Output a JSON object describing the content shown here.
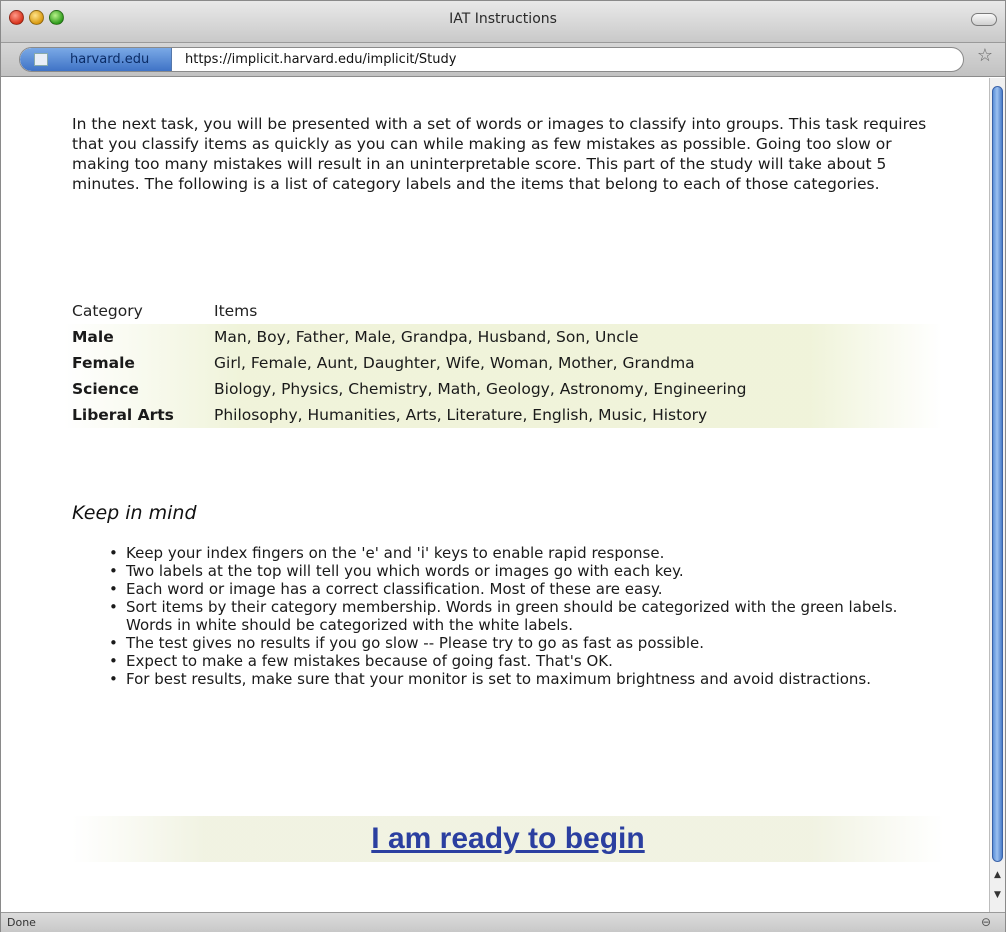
{
  "window": {
    "title": "IAT Instructions"
  },
  "urlbar": {
    "site_label": "harvard.edu",
    "url": "https://implicit.harvard.edu/implicit/Study"
  },
  "content": {
    "intro": "In the next task, you will be presented with a set of words or images to classify into groups. This task requires that you classify items as quickly as you can while making as few mistakes as possible. Going too slow or making too many mistakes will result in an uninterpretable score. This part of the study will take about 5 minutes. The following is a list of category labels and the items that belong to each of those categories.",
    "table": {
      "headers": [
        "Category",
        "Items"
      ],
      "rows": [
        {
          "category": "Male",
          "items": "Man, Boy, Father, Male, Grandpa, Husband, Son, Uncle"
        },
        {
          "category": "Female",
          "items": "Girl, Female, Aunt, Daughter, Wife, Woman, Mother, Grandma"
        },
        {
          "category": "Science",
          "items": "Biology, Physics, Chemistry, Math, Geology, Astronomy, Engineering"
        },
        {
          "category": "Liberal Arts",
          "items": "Philosophy, Humanities, Arts, Literature, English, Music, History"
        }
      ]
    },
    "keep_in_mind": "Keep in mind",
    "tips": [
      "Keep your index fingers on the 'e' and 'i' keys to enable rapid response.",
      "Two labels at the top will tell you which words or images go with each key.",
      "Each word or image has a correct classification. Most of these are easy.",
      "Sort items by their category membership. Words in green should be categorized with the green labels. Words in white should be categorized with the white labels.",
      "The test gives no results if you go slow -- Please try to go as fast as possible.",
      "Expect to make a few mistakes because of going fast. That's OK.",
      "For best results, make sure that your monitor is set to maximum brightness and avoid distractions."
    ],
    "begin_link": "I am ready to begin"
  },
  "statusbar": {
    "text": "Done"
  },
  "icons": {
    "close": "close-icon",
    "minimize": "minimize-icon",
    "zoom": "zoom-icon",
    "bookmark": "star-icon",
    "lock": "lock-icon"
  },
  "colors": {
    "link": "#2b3fa0",
    "site_id": "#3f73c6",
    "row_highlight": "#eef2d6"
  }
}
